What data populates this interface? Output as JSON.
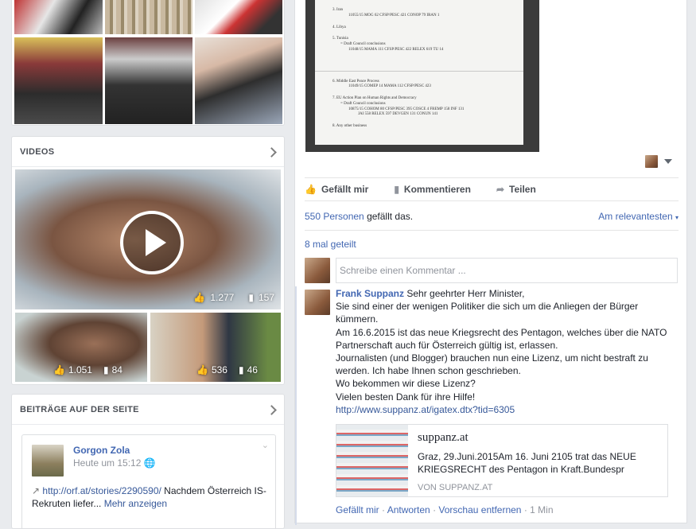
{
  "videos_section": {
    "title": "VIDEOS"
  },
  "videos": [
    {
      "likes": "1.277",
      "comments": "157"
    },
    {
      "likes": "1.051",
      "comments": "84"
    },
    {
      "likes": "536",
      "comments": "46"
    }
  ],
  "posts_section": {
    "title": "BEITRÄGE AUF DER SEITE"
  },
  "page_post": {
    "author": "Gorgon Zola",
    "time": "Heute um 15:12",
    "link": "http://orf.at/stories/2290590/",
    "text": " Nachdem Österreich IS-Rekruten liefer...",
    "more": " Mehr anzeigen"
  },
  "post_actions": {
    "like": "Gefällt mir",
    "comment": "Kommentieren",
    "share": "Teilen"
  },
  "reactions": {
    "count_link": "550 Personen",
    "count_rest": " gefällt das.",
    "sort": "Am relevantesten",
    "shares": "8 mal geteilt"
  },
  "comment_input": {
    "placeholder": "Schreibe einen Kommentar ..."
  },
  "comment": {
    "author": "Frank Suppanz",
    "lines": [
      " Sehr geehrter Herr Minister,",
      "Sie sind einer der wenigen Politiker die sich um die Anliegen der Bürger kümmern.",
      "Am 16.6.2015 ist das neue Kriegsrecht des Pentagon, welches über die NATO Partnerschaft auch für Österreich gültig ist, erlassen.",
      "Journalisten (und Blogger) brauchen nun eine Lizenz, um nicht bestraft zu werden. Ich habe Ihnen schon geschrieben.",
      "Wo bekommen wir diese Lizenz?",
      "Vielen besten Dank für ihre Hilfe!"
    ],
    "url": "http://www.suppanz.at/igatex.dtx?tid=6305",
    "preview": {
      "title": "suppanz.at",
      "desc": "Graz, 29.Juni.2015Am 16. Juni 2105 trat das NEUE KRIEGSRECHT des Pentagon in Kraft.Bundespr",
      "source": "VON SUPPANZ.AT"
    },
    "footer": {
      "like": "Gefällt mir",
      "sep": " · ",
      "reply": "Antworten",
      "remove": "Vorschau entfernen",
      "time": "1 Min"
    }
  },
  "document_lines": [
    "3.   Iran",
    "11055/15 MOG 62 CFSP/PESC 421 CONOP 79 IRAN 1",
    "4.   Libya",
    "5.   Tunisia",
    "= Draft Council conclusions",
    "11048/15 MAMA 111 CFSP/PESC 422 RELEX 619 TU 14",
    "6.   Middle East Peace Process",
    "11049/15 COMEP 14 MAMA 112 CFSP/PESC 423",
    "7.   EU Action Plan on Human Rights and Democracy",
    "= Draft Council conclusions",
    "10875/15 COHOM 80 CFSP/PESC 395 COSCE 4 FREMP 158 INF 131",
    "JAI 558 RELEX 597 DEVGEN 131 CONUN 141",
    "8.   Any other business"
  ]
}
